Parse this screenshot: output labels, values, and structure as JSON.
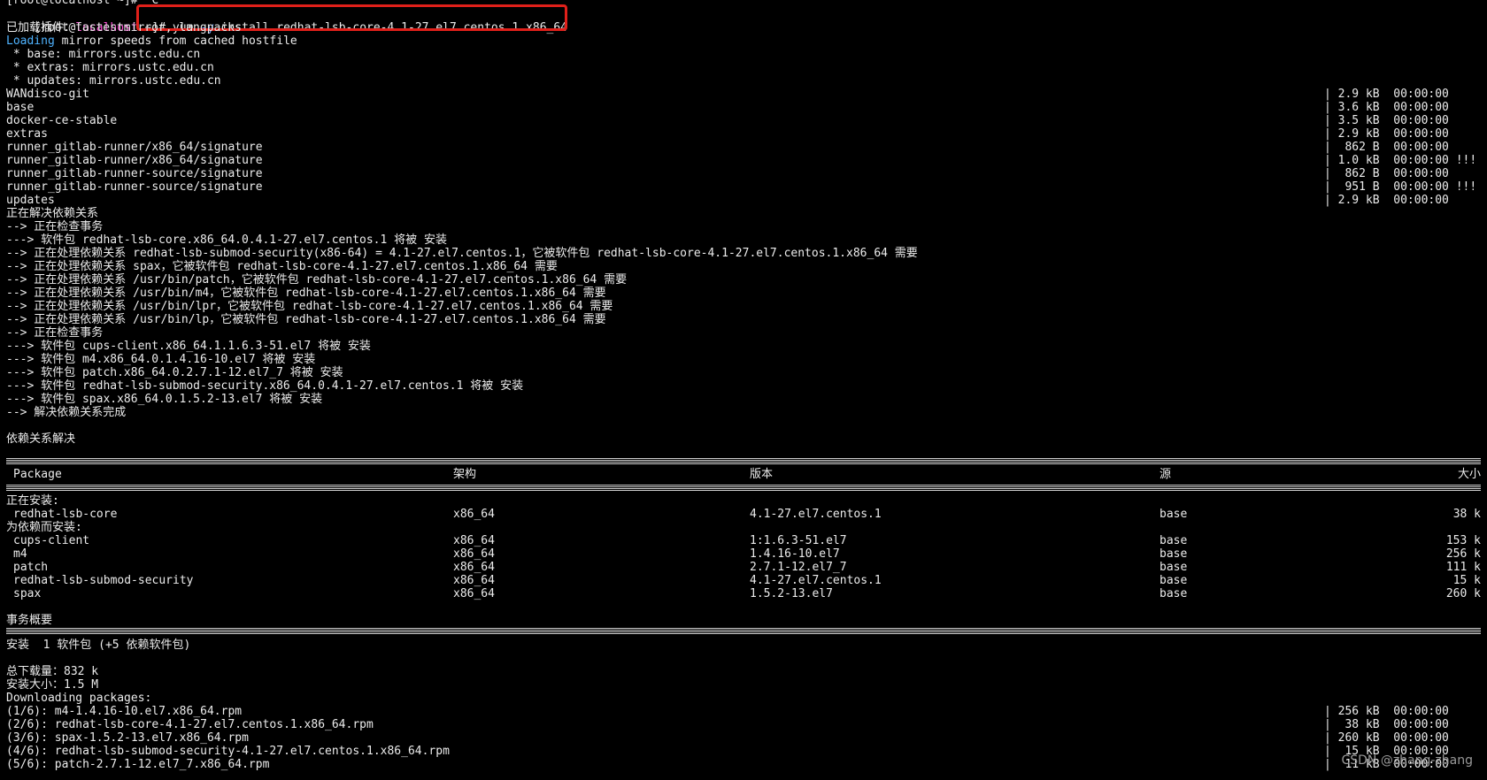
{
  "prompt": {
    "prev_line": "[root@localhost ~]# ^C",
    "user_host_left": "[root@",
    "host": "localhost",
    "path_part": " ~]#",
    "command_pre": " yum ",
    "command_flag": "-y",
    "command_rest": " install redhat-lsb-core-4.1-27.el7.centos.1.x86_64"
  },
  "plugins_line": "已加载插件：fastestmirror, langpacks",
  "loading": {
    "word": "Loading",
    "rest": " mirror speeds from cached hostfile"
  },
  "mirrors": [
    " * base: mirrors.ustc.edu.cn",
    " * extras: mirrors.ustc.edu.cn",
    " * updates: mirrors.ustc.edu.cn"
  ],
  "repos": [
    {
      "name": "WANdisco-git",
      "size": "| 2.9 kB  00:00:00"
    },
    {
      "name": "base",
      "size": "| 3.6 kB  00:00:00"
    },
    {
      "name": "docker-ce-stable",
      "size": "| 3.5 kB  00:00:00"
    },
    {
      "name": "extras",
      "size": "| 2.9 kB  00:00:00"
    },
    {
      "name": "runner_gitlab-runner/x86_64/signature",
      "size": "|  862 B  00:00:00"
    },
    {
      "name": "runner_gitlab-runner/x86_64/signature",
      "size": "| 1.0 kB  00:00:00 !!!"
    },
    {
      "name": "runner_gitlab-runner-source/signature",
      "size": "|  862 B  00:00:00"
    },
    {
      "name": "runner_gitlab-runner-source/signature",
      "size": "|  951 B  00:00:00 !!!"
    },
    {
      "name": "updates",
      "size": "| 2.9 kB  00:00:00"
    }
  ],
  "resolve_lines": [
    "正在解决依赖关系",
    "--> 正在检查事务",
    "---> 软件包 redhat-lsb-core.x86_64.0.4.1-27.el7.centos.1 将被 安装",
    "--> 正在处理依赖关系 redhat-lsb-submod-security(x86-64) = 4.1-27.el7.centos.1，它被软件包 redhat-lsb-core-4.1-27.el7.centos.1.x86_64 需要",
    "--> 正在处理依赖关系 spax，它被软件包 redhat-lsb-core-4.1-27.el7.centos.1.x86_64 需要",
    "--> 正在处理依赖关系 /usr/bin/patch，它被软件包 redhat-lsb-core-4.1-27.el7.centos.1.x86_64 需要",
    "--> 正在处理依赖关系 /usr/bin/m4，它被软件包 redhat-lsb-core-4.1-27.el7.centos.1.x86_64 需要",
    "--> 正在处理依赖关系 /usr/bin/lpr，它被软件包 redhat-lsb-core-4.1-27.el7.centos.1.x86_64 需要",
    "--> 正在处理依赖关系 /usr/bin/lp，它被软件包 redhat-lsb-core-4.1-27.el7.centos.1.x86_64 需要",
    "--> 正在检查事务",
    "---> 软件包 cups-client.x86_64.1.1.6.3-51.el7 将被 安装",
    "---> 软件包 m4.x86_64.0.1.4.16-10.el7 将被 安装",
    "---> 软件包 patch.x86_64.0.2.7.1-12.el7_7 将被 安装",
    "---> 软件包 redhat-lsb-submod-security.x86_64.0.4.1-27.el7.centos.1 将被 安装",
    "---> 软件包 spax.x86_64.0.1.5.2-13.el7 将被 安装",
    "--> 解决依赖关系完成"
  ],
  "deps_resolved": "依赖关系解决",
  "table": {
    "headers": {
      "package": "Package",
      "arch": "架构",
      "version": "版本",
      "repo": "源",
      "size": "大小"
    },
    "installing_label": "正在安装:",
    "installing": [
      {
        "package": "redhat-lsb-core",
        "arch": "x86_64",
        "version": "4.1-27.el7.centos.1",
        "repo": "base",
        "size": "38 k"
      }
    ],
    "deps_label": "为依赖而安装:",
    "deps": [
      {
        "package": "cups-client",
        "arch": "x86_64",
        "version": "1:1.6.3-51.el7",
        "repo": "base",
        "size": "153 k"
      },
      {
        "package": "m4",
        "arch": "x86_64",
        "version": "1.4.16-10.el7",
        "repo": "base",
        "size": "256 k"
      },
      {
        "package": "patch",
        "arch": "x86_64",
        "version": "2.7.1-12.el7_7",
        "repo": "base",
        "size": "111 k"
      },
      {
        "package": "redhat-lsb-submod-security",
        "arch": "x86_64",
        "version": "4.1-27.el7.centos.1",
        "repo": "base",
        "size": "15 k"
      },
      {
        "package": "spax",
        "arch": "x86_64",
        "version": "1.5.2-13.el7",
        "repo": "base",
        "size": "260 k"
      }
    ]
  },
  "summary": {
    "title": "事务概要",
    "install_line": "安装  1 软件包 (+5 依赖软件包)",
    "download_total": "总下载量：832 k",
    "install_size": "安装大小：1.5 M",
    "downloading": "Downloading packages:"
  },
  "downloads": [
    {
      "file": "(1/6): m4-1.4.16-10.el7.x86_64.rpm",
      "size": "| 256 kB  00:00:00"
    },
    {
      "file": "(2/6): redhat-lsb-core-4.1-27.el7.centos.1.x86_64.rpm",
      "size": "|  38 kB  00:00:00"
    },
    {
      "file": "(3/6): spax-1.5.2-13.el7.x86_64.rpm",
      "size": "| 260 kB  00:00:00"
    },
    {
      "file": "(4/6): redhat-lsb-submod-security-4.1-27.el7.centos.1.x86_64.rpm",
      "size": "|  15 kB  00:00:00"
    },
    {
      "file": "(5/6): patch-2.7.1-12.el7_7.x86_64.rpm",
      "size": "|  11 kB  00:00:00"
    }
  ],
  "watermark": "CSDN @zhang-zhang",
  "colors": {
    "background": "#000000",
    "text": "#ececec",
    "host": "#ff4fd8",
    "highlight_box": "#e0201a",
    "loading": "#4fb3ff"
  }
}
